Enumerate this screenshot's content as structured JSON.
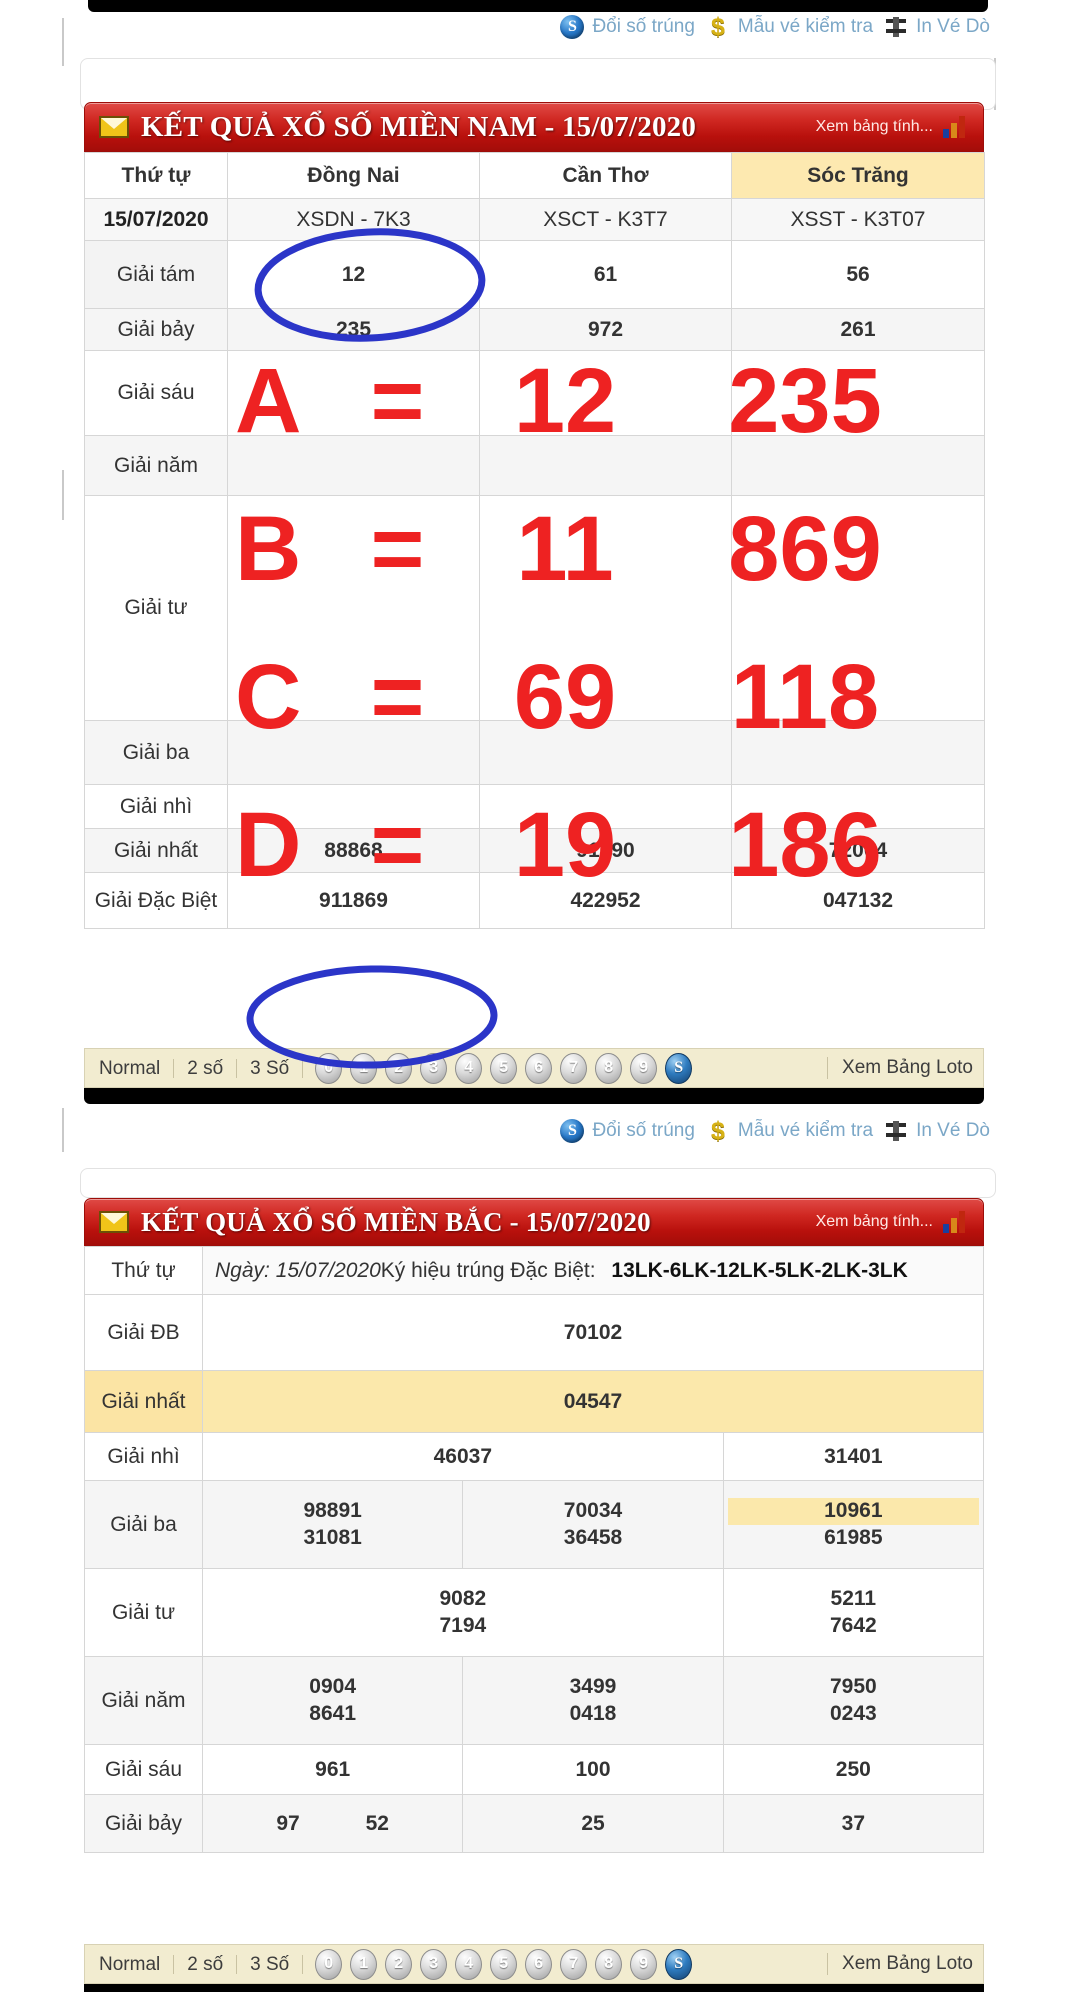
{
  "toolbar": {
    "links": [
      {
        "label": "Đổi số trúng",
        "icon": "globe-icon"
      },
      {
        "label": "Mẫu vé kiểm tra",
        "icon": "dollar-icon"
      },
      {
        "label": "In Vé Dò",
        "icon": "printer-icon"
      }
    ]
  },
  "south": {
    "title": "KẾT QUẢ XỔ SỐ MIỀN NAM - 15/07/2020",
    "view_chart_label": "Xem bảng tính...",
    "mail_icon": "mail-icon",
    "chart_icon": "bar-chart-icon",
    "columns": [
      "Thứ tự",
      "Đồng Nai",
      "Cần Thơ",
      "Sóc Trăng"
    ],
    "date": "15/07/2020",
    "codes": [
      "XSDN - 7K3",
      "XSCT - K3T7",
      "XSST - K3T07"
    ],
    "rows": [
      {
        "label": "Giải tám",
        "values": [
          "12",
          "61",
          "56"
        ],
        "style": "big-red"
      },
      {
        "label": "Giải bảy",
        "values": [
          "235",
          "972",
          "261"
        ],
        "style": "med-dark"
      },
      {
        "label": "Giải sáu",
        "values": [
          "",
          "",
          ""
        ],
        "style": "med-dark"
      },
      {
        "label": "Giải năm",
        "values": [
          "",
          "",
          ""
        ],
        "style": "med-dark"
      },
      {
        "label": "Giải tư",
        "values": [
          "",
          "",
          ""
        ],
        "style": "med-dark"
      },
      {
        "label": "Giải ba",
        "values": [
          "",
          "",
          ""
        ],
        "style": "med-dark"
      },
      {
        "label": "Giải nhì",
        "values": [
          "",
          "",
          ""
        ],
        "style": "med-dark"
      },
      {
        "label": "Giải nhất",
        "values": [
          "88868",
          "91090",
          "72004"
        ],
        "style": "g1"
      },
      {
        "label": "Giải Đặc Biệt",
        "values": [
          "911869",
          "422952",
          "047132"
        ],
        "style": "db-red"
      }
    ],
    "footer": {
      "segments": [
        "Normal",
        "2 số",
        "3 Số"
      ],
      "balls": [
        "0",
        "1",
        "2",
        "3",
        "4",
        "5",
        "6",
        "7",
        "8",
        "9",
        "S"
      ],
      "loto_label": "Xem Bảng Loto"
    }
  },
  "annotation": {
    "rows": [
      {
        "letter": "A",
        "eq": "=",
        "a": "12",
        "b": "235"
      },
      {
        "letter": "B",
        "eq": "=",
        "a": "11",
        "b": "869"
      },
      {
        "letter": "C",
        "eq": "=",
        "a": "69",
        "b": "118"
      },
      {
        "letter": "D",
        "eq": "=",
        "a": "19",
        "b": "186"
      }
    ],
    "circled_values": [
      "12",
      "911869"
    ],
    "ink_color": "#2b35c8",
    "text_color": "#ee2222"
  },
  "north": {
    "title": "KẾT QUẢ XỔ SỐ MIỀN BẮC - 15/07/2020",
    "view_chart_label": "Xem bảng tính...",
    "mail_icon": "mail-icon",
    "chart_icon": "bar-chart-icon",
    "order_label": "Thứ tự",
    "date_prefix": "Ngày: 15/07/2020",
    "special_code_label": "Ký hiệu trúng Đặc Biệt:",
    "special_codes": "13LK-6LK-12LK-5LK-2LK-3LK",
    "rows": [
      {
        "label": "Giải ĐB",
        "values": [
          "70102"
        ],
        "style": "mb-db"
      },
      {
        "label": "Giải nhất",
        "values": [
          "04547"
        ],
        "style": "mb-g1"
      },
      {
        "label": "Giải nhì",
        "values": [
          "46037",
          "31401"
        ],
        "style": "mb-num"
      },
      {
        "label": "Giải ba",
        "values": [
          "98891",
          "70034",
          "10961",
          "31081",
          "36458",
          "61985"
        ],
        "style": "mb-num"
      },
      {
        "label": "Giải tư",
        "values": [
          "9082",
          "5211",
          "7194",
          "7642"
        ],
        "style": "mb-num"
      },
      {
        "label": "Giải năm",
        "values": [
          "0904",
          "3499",
          "7950",
          "8641",
          "0418",
          "0243"
        ],
        "style": "mb-num"
      },
      {
        "label": "Giải sáu",
        "values": [
          "961",
          "100",
          "250"
        ],
        "style": "mb-num"
      },
      {
        "label": "Giải bảy",
        "values": [
          "97",
          "52",
          "25",
          "37"
        ],
        "style": "mb-g7"
      }
    ],
    "footer": {
      "segments": [
        "Normal",
        "2 số",
        "3 Số"
      ],
      "balls": [
        "0",
        "1",
        "2",
        "3",
        "4",
        "5",
        "6",
        "7",
        "8",
        "9",
        "S"
      ],
      "loto_label": "Xem Bảng Loto"
    }
  },
  "colors": {
    "header_red": "#b8100c",
    "prize_red": "#9e1219",
    "ink_blue": "#2b35c8",
    "highlight_yellow": "#fbe8ab",
    "link_blue": "#7ba7c7"
  }
}
